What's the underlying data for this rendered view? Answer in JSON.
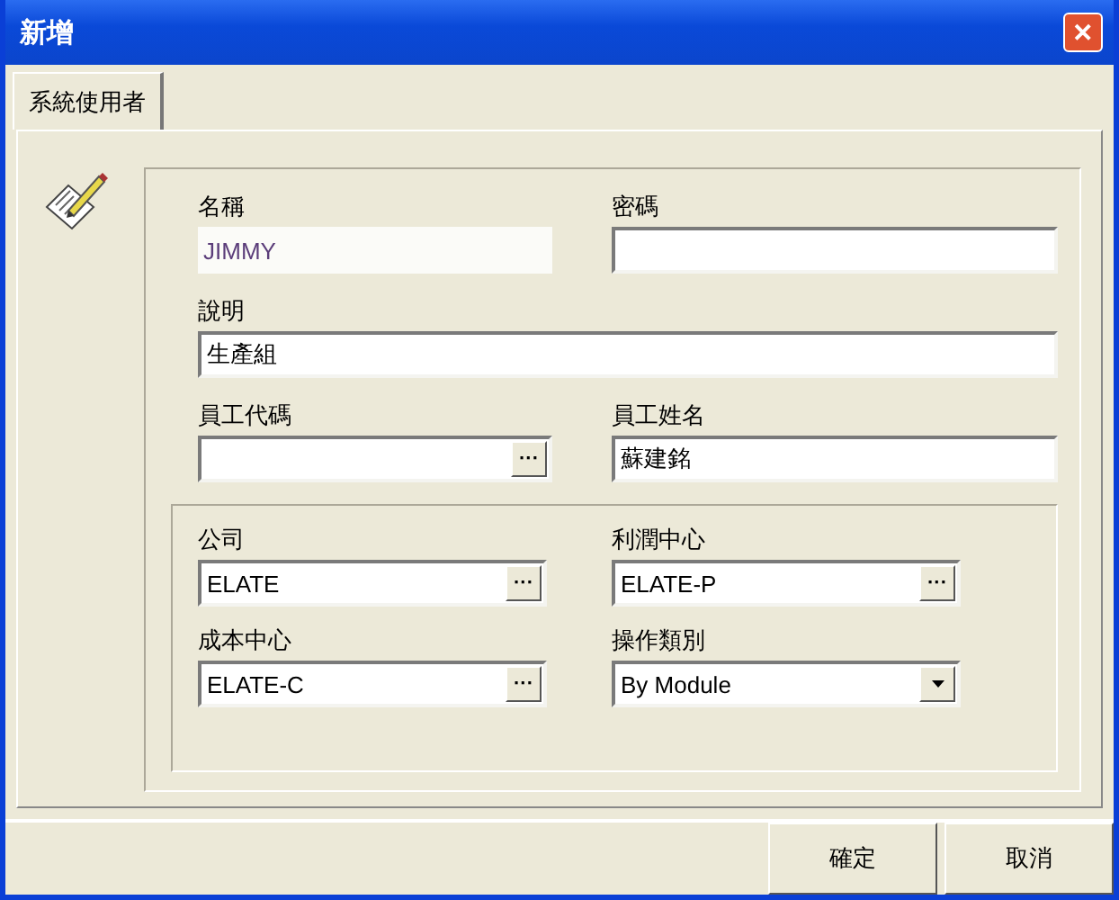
{
  "window": {
    "title": "新增",
    "close": "✕"
  },
  "tabs": [
    {
      "label": "系統使用者",
      "selected": true
    }
  ],
  "rows": [
    [
      {
        "label": "名稱",
        "kind": "plain",
        "value": "JIMMY"
      },
      {
        "label": "密碼",
        "kind": "text"
      }
    ],
    [
      {
        "label": "說明",
        "kind": "text",
        "value": "生產組"
      }
    ],
    [
      {
        "label": "員工代碼",
        "kind": "lookup",
        "button": "···"
      },
      {
        "label": "員工姓名",
        "kind": "text",
        "value": "蘇建銘"
      }
    ]
  ],
  "group_rows": [
    [
      {
        "label": "公司",
        "kind": "lookup",
        "value": "ELATE",
        "button": "···"
      },
      {
        "label": "利潤中心",
        "kind": "lookup",
        "value": "ELATE-P",
        "button": "···"
      }
    ],
    [
      {
        "label": "成本中心",
        "kind": "lookup",
        "value": "ELATE-C",
        "button": "···"
      },
      {
        "label": "操作類別",
        "kind": "select",
        "value": "By Module"
      }
    ]
  ],
  "buttons": [
    "確定",
    "取消"
  ]
}
